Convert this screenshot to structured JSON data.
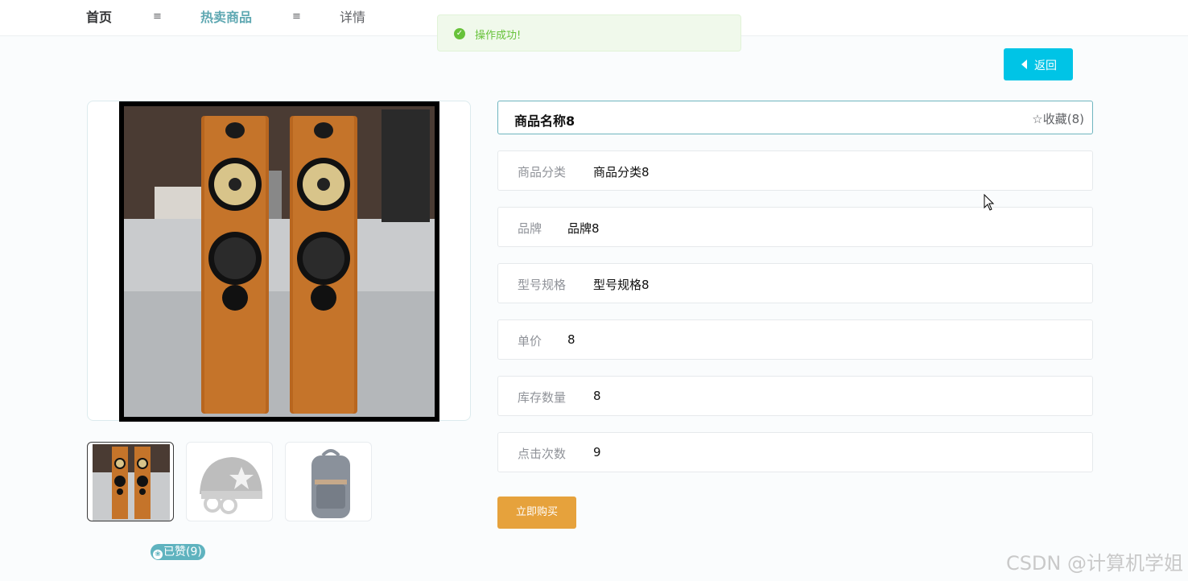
{
  "nav": {
    "home": "首页",
    "separator": "≡",
    "hot": "热卖商品",
    "detail": "详情"
  },
  "toast": {
    "message": "操作成功!",
    "icon": "check-circle-icon",
    "color": "#67c23a"
  },
  "back_button": {
    "label": "返回",
    "icon": "caret-left-icon",
    "color": "#00c4e6"
  },
  "product": {
    "name": "商品名称8",
    "favorite": "☆收藏(8)",
    "fields": [
      {
        "key": "商品分类",
        "value": "商品分类8"
      },
      {
        "key": "品牌",
        "value": "品牌8"
      },
      {
        "key": "型号规格",
        "value": "型号规格8"
      },
      {
        "key": "单价",
        "value": "8"
      },
      {
        "key": "库存数量",
        "value": "8"
      },
      {
        "key": "点击次数",
        "value": "9"
      }
    ],
    "buy_label": "立即购买"
  },
  "gallery": {
    "main_image": "wooden-floor-speakers-image",
    "thumbnails": [
      "speakers-thumbnail",
      "helmet-thumbnail",
      "backpack-thumbnail"
    ],
    "like_label": "已赞(9)"
  },
  "watermark": "CSDN @计算机学姐",
  "colors": {
    "accent": "#5fa8b2",
    "buy": "#e6a23c",
    "back": "#00c4e6",
    "success": "#67c23a"
  }
}
